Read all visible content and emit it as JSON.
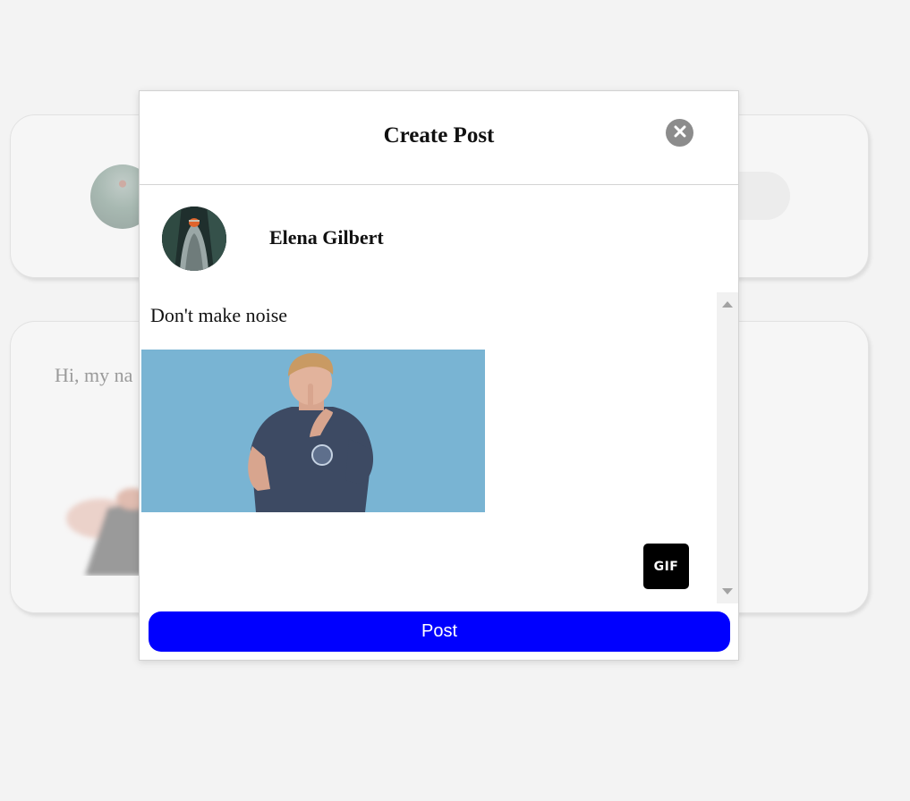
{
  "background": {
    "post_preview_text": "Hi, my na"
  },
  "modal": {
    "title": "Create Post",
    "close_icon": "close-icon",
    "author": {
      "name": "Elena Gilbert"
    },
    "post_text": "Don't make noise",
    "gif_button_label": "GIF",
    "post_button_label": "Post",
    "colors": {
      "post_button": "#0000ff",
      "gif_background": "#79b4d3",
      "close_button": "#8c8c8c"
    }
  }
}
